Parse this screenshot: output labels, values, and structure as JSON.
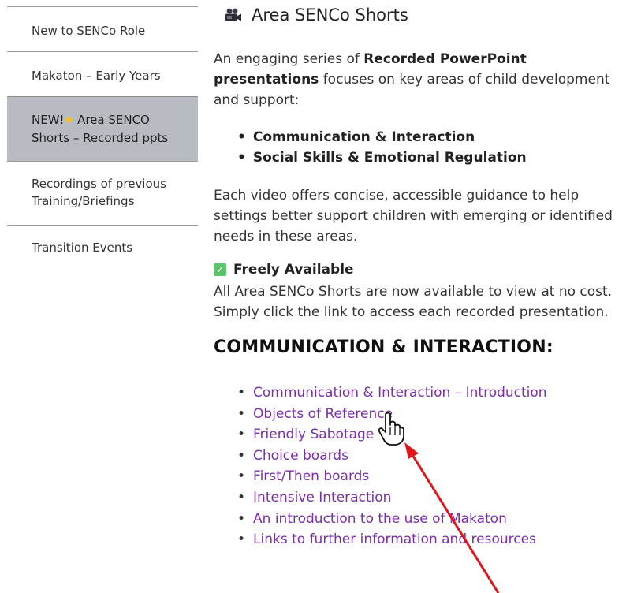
{
  "sidebar": {
    "items": [
      {
        "label": "New to SENCo Role"
      },
      {
        "label": "Makaton – Early Years"
      },
      {
        "label_prefix": "NEW!",
        "label": "Area SENCO Shorts – Recorded ppts",
        "icon": "sparkle-star-icon"
      },
      {
        "label": "Recordings of previous Training/Briefings"
      },
      {
        "label": "Transition Events"
      }
    ]
  },
  "main": {
    "title": "Area SENCo Shorts",
    "title_icon": "film-camera-icon",
    "intro_start": "An engaging series of ",
    "intro_bold": "Recorded PowerPoint presentations",
    "intro_end": " focuses on key areas of child development and support:",
    "bullets": [
      "Communication & Interaction",
      "Social Skills & Emotional Regulation"
    ],
    "para2": "Each video offers concise, accessible guidance to help settings better support children with emerging or identified needs in these areas.",
    "free_heading": "Freely Available",
    "free_icon": "check-mark-icon",
    "para3": "All Area SENCo Shorts are now available to view at no cost. Simply click the link to access each recorded presentation.",
    "section_heading": "COMMUNICATION & INTERACTION:",
    "links": [
      "Communication & Interaction – Introduction",
      "Objects of Reference",
      "Friendly Sabotage",
      "Choice boards",
      "First/Then boards",
      "Intensive Interaction",
      "An introduction to the use of Makaton",
      "Links to further information and resources"
    ]
  },
  "colors": {
    "link": "#7b2fa8",
    "sidebar_active_bg": "#b8bcc2",
    "annotation_arrow": "#e0161b",
    "check_green": "#5cc46a"
  },
  "overlay": {
    "cursor_icon": "hand-pointer-icon",
    "annotation": "red-arrow-icon"
  }
}
